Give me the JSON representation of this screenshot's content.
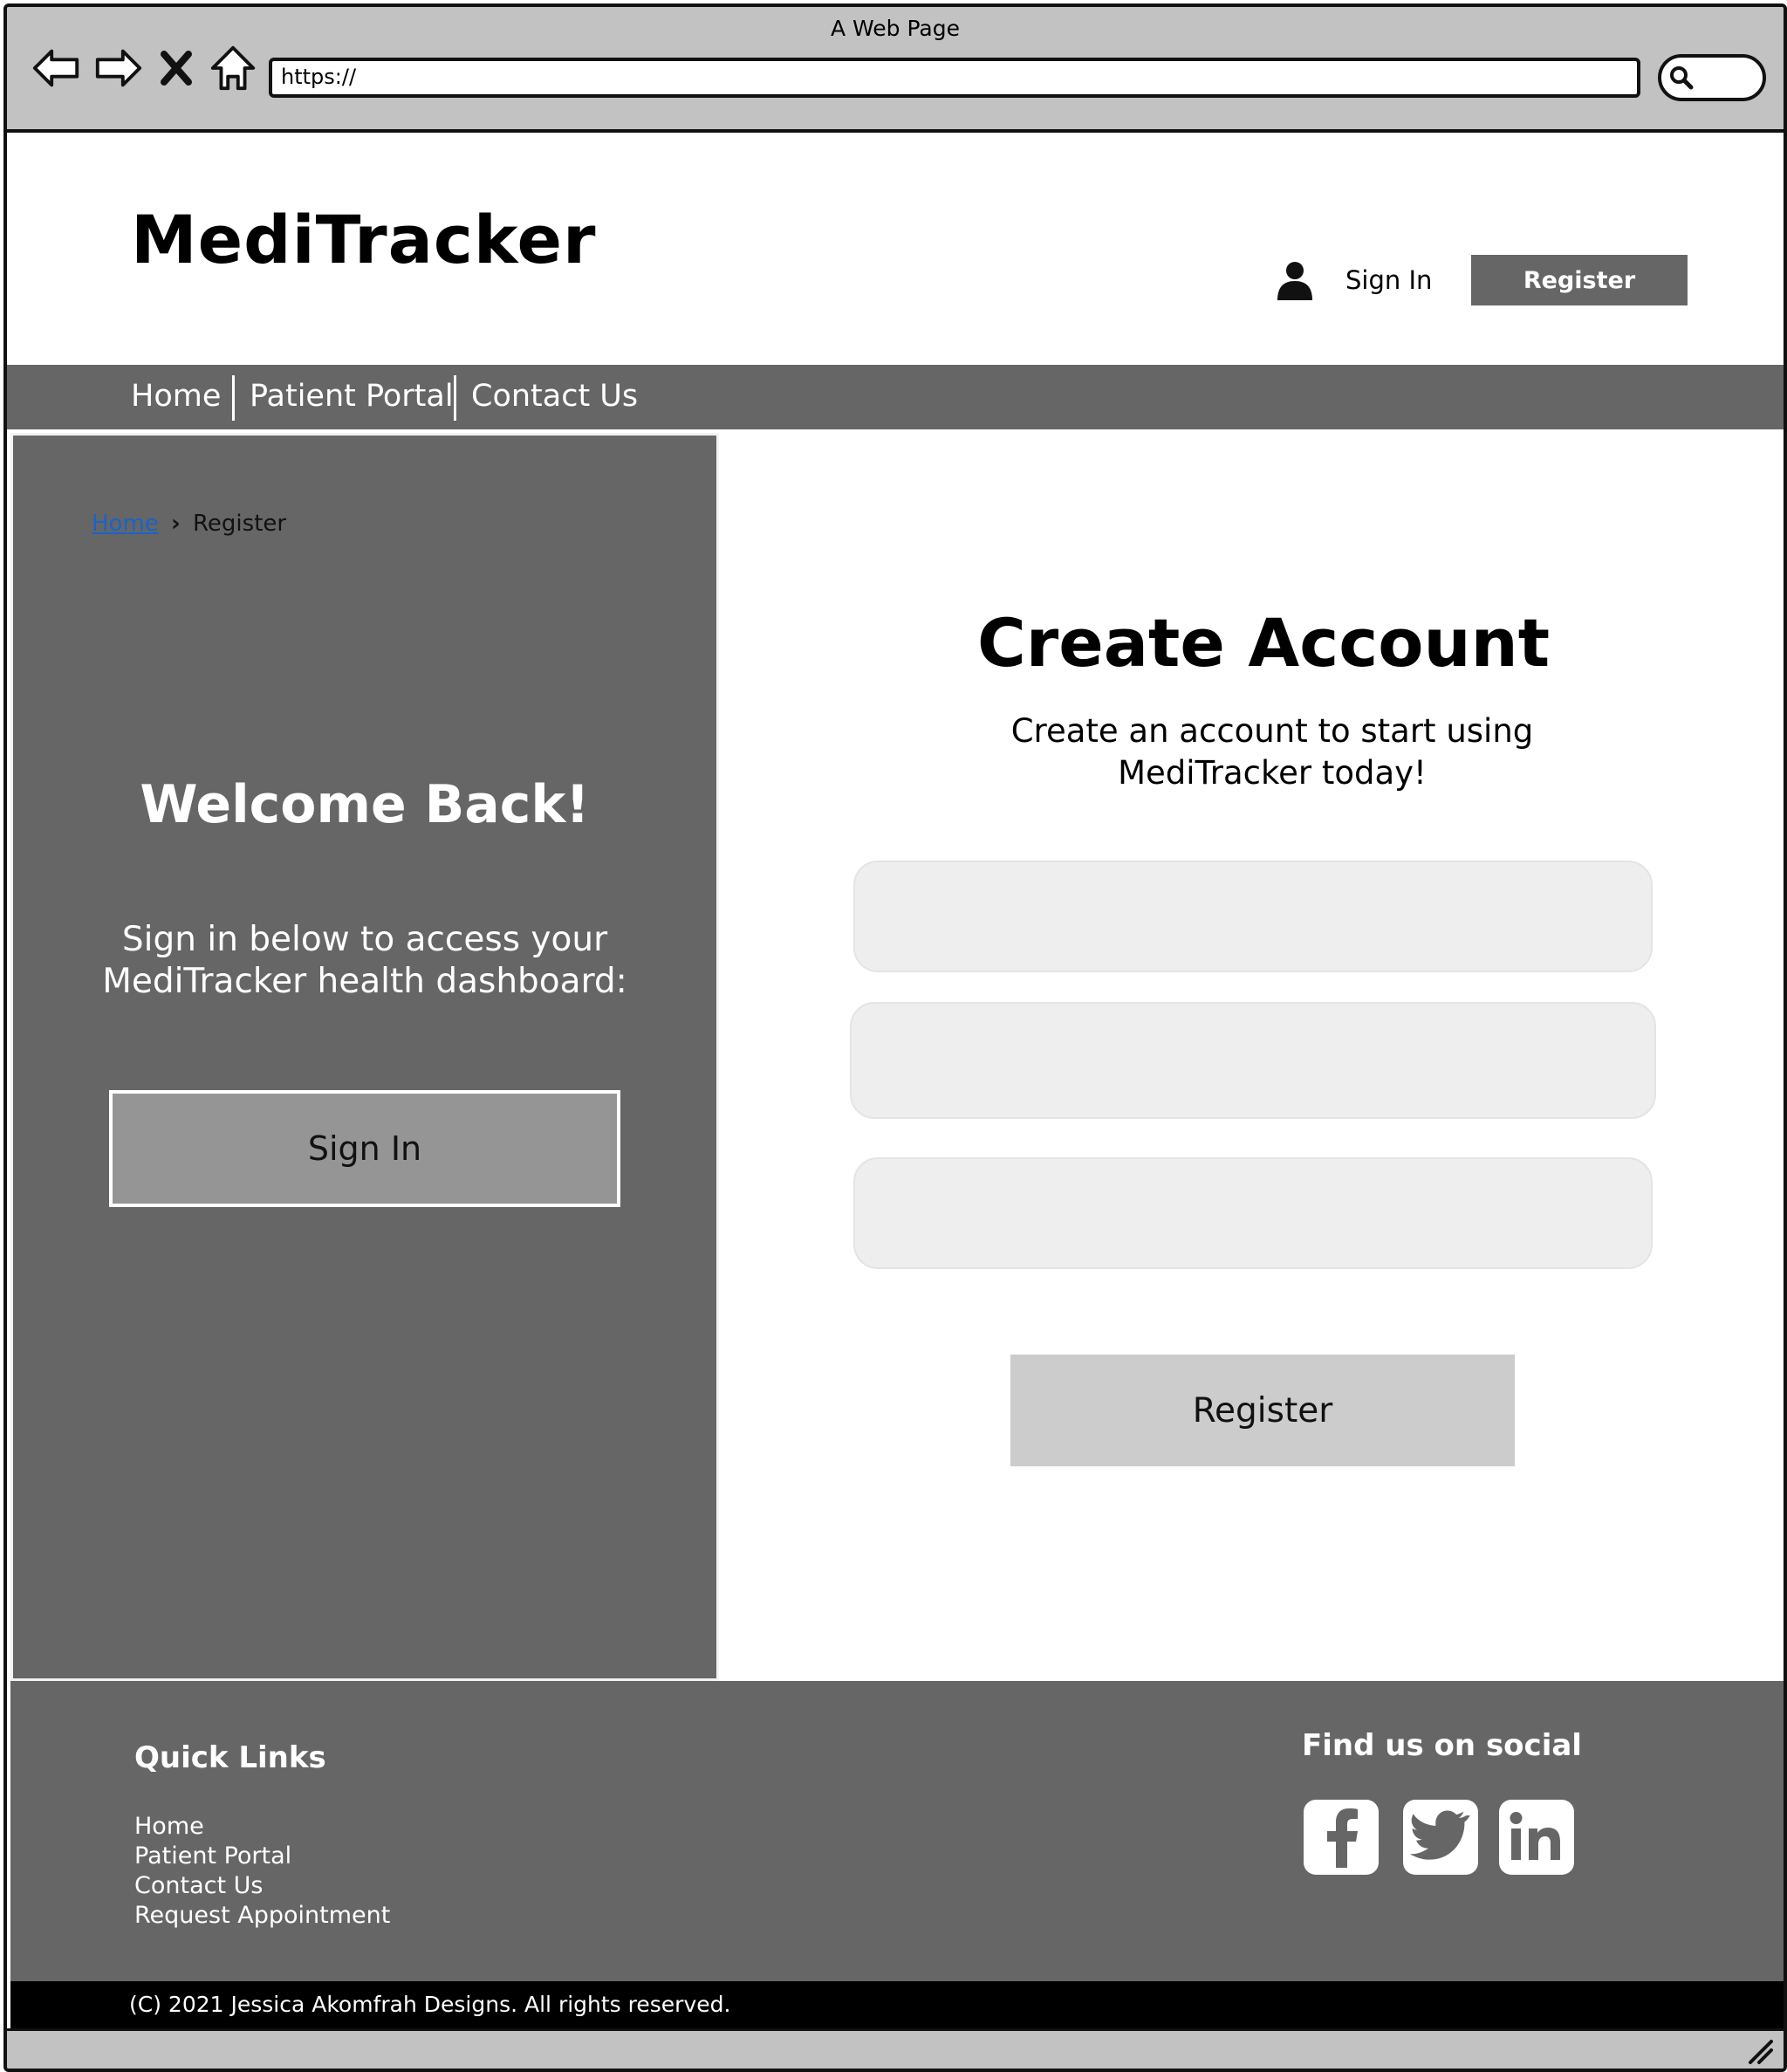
{
  "window": {
    "title": "A Web Page"
  },
  "browser": {
    "address": "https://",
    "icons": [
      "back-arrow-icon",
      "forward-arrow-icon",
      "close-x-icon",
      "home-icon",
      "search-icon"
    ]
  },
  "header": {
    "logo": "MediTracker",
    "signin_label": "Sign In",
    "register_label": "Register",
    "user_icon": "user-icon"
  },
  "nav": {
    "items": [
      {
        "label": "Home"
      },
      {
        "label": "Patient Portal"
      },
      {
        "label": "Contact Us"
      }
    ]
  },
  "left_panel": {
    "breadcrumb": {
      "home": "Home",
      "current": "Register"
    },
    "heading": "Welcome Back!",
    "subtext_line1": "Sign in below to access your",
    "subtext_line2": "MediTracker health dashboard:",
    "signin_button": "Sign In"
  },
  "main": {
    "title": "Create Account",
    "subtitle_line1": "Create an account to start using",
    "subtitle_line2": "MediTracker today!",
    "fields": [
      {
        "value": ""
      },
      {
        "value": ""
      },
      {
        "value": ""
      }
    ],
    "register_button": "Register"
  },
  "footer": {
    "quick_links_title": "Quick Links",
    "quick_links": [
      {
        "label": "Home"
      },
      {
        "label": "Patient Portal"
      },
      {
        "label": "Contact Us"
      },
      {
        "label": "Request Appointment"
      }
    ],
    "social_title": "Find us on social",
    "social_icons": [
      "facebook-icon",
      "twitter-icon",
      "linkedin-icon"
    ],
    "copyright": "(C) 2021 Jessica Akomfrah Designs. All rights reserved."
  },
  "colors": {
    "chrome": "#c2c2c2",
    "dark_gray": "#666666",
    "button_gray": "#959595",
    "light_button": "#cccccc",
    "field_bg": "#eeeeee",
    "link_blue": "#1a63c8"
  }
}
